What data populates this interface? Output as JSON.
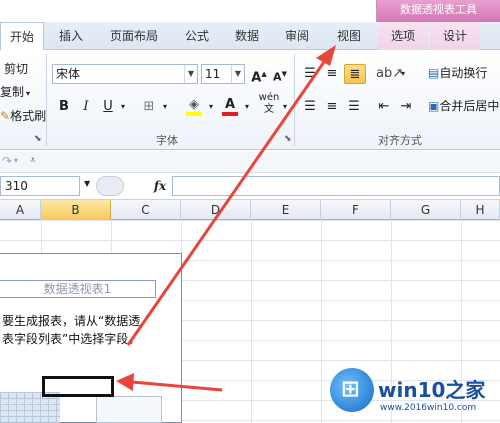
{
  "ribbon_tabs": {
    "context_group": "数据透视表工具",
    "tabs": [
      "开始",
      "插入",
      "页面布局",
      "公式",
      "数据",
      "审阅",
      "视图",
      "选项",
      "设计"
    ]
  },
  "clipboard": {
    "cut": "剪切",
    "copy": "复制",
    "format_painter": "格式刷"
  },
  "font": {
    "font_name": "宋体",
    "font_size": "11",
    "bold": "B",
    "italic": "I",
    "underline": "U",
    "grow": "A",
    "shrink": "A",
    "group_label": "字体"
  },
  "alignment": {
    "wrap_text": "自动换行",
    "merge_center": "合并后居中",
    "group_label": "对齐方式"
  },
  "formula_bar": {
    "name_box": "310",
    "fx": "fx"
  },
  "columns": [
    "A",
    "B",
    "C",
    "D",
    "E",
    "F",
    "G",
    "H"
  ],
  "pivot": {
    "title": "数据透视表1",
    "line1": "要生成报表，请从“数据透",
    "line2": "表字段列表”中选择字段。"
  },
  "watermark": {
    "name": "win10之家",
    "url": "www.2016win10.com"
  },
  "colors": {
    "annotation_arrow": "#e8453c",
    "context_tab": "#d377b5",
    "selected_header": "#f6c85a"
  }
}
